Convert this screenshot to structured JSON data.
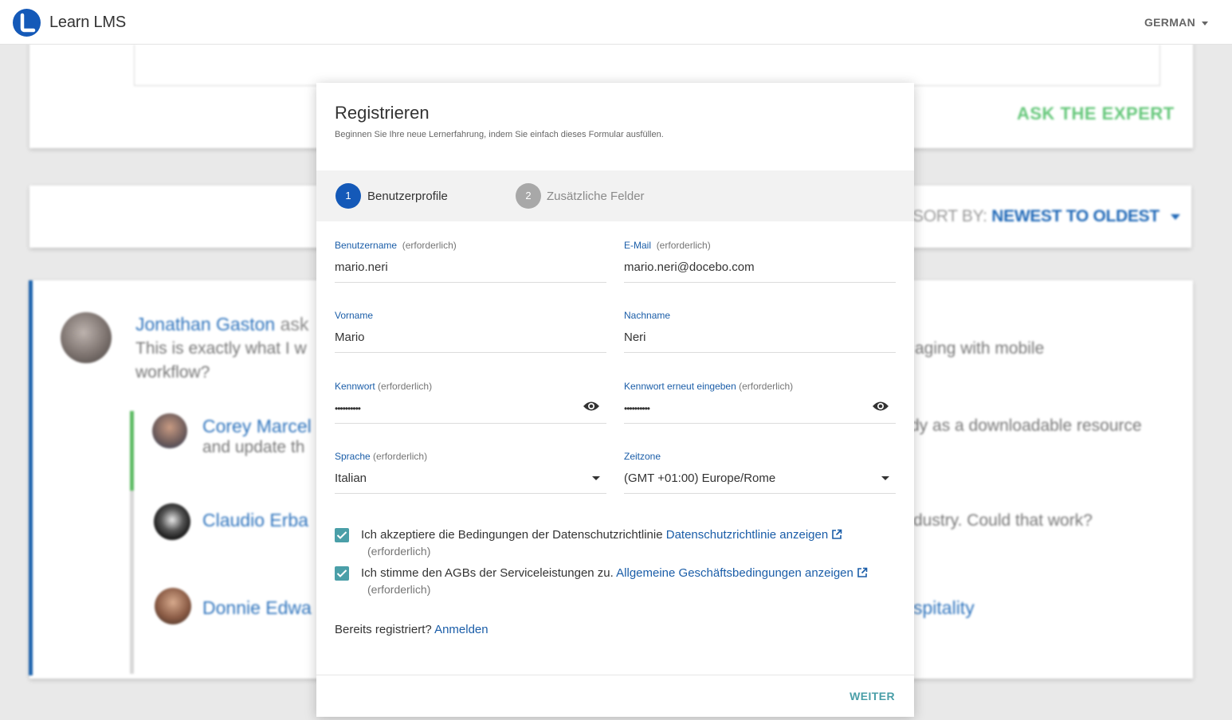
{
  "header": {
    "app_title": "Learn LMS",
    "language": "GERMAN"
  },
  "background": {
    "ask_expert": "ASK THE EXPERT",
    "sort_label": "SORT BY:",
    "sort_value": "NEWEST TO OLDEST",
    "posts": [
      {
        "name": "Jonathan Gaston",
        "action": "ask",
        "text_left": "This is exactly what I w",
        "text_left2": "workflow?",
        "text_right": "aging with mobile"
      },
      {
        "name": "Corey Marcel",
        "text_left": "and update th",
        "text_right": "dy as a downloadable resource"
      },
      {
        "name": "Claudio Erba",
        "text_right": "dustry.  Could that work?"
      },
      {
        "name": "Donnie Edwa",
        "text_right": "spitality"
      }
    ]
  },
  "modal": {
    "title": "Registrieren",
    "subtitle": "Beginnen Sie Ihre neue Lernerfahrung, indem Sie einfach dieses Formular ausfüllen.",
    "steps": [
      {
        "number": "1",
        "label": "Benutzerprofile",
        "active": true
      },
      {
        "number": "2",
        "label": "Zusätzliche Felder",
        "active": false
      }
    ],
    "fields": {
      "username": {
        "label": "Benutzername",
        "required": "(erforderlich)",
        "value": "mario.neri"
      },
      "email": {
        "label": "E-Mail",
        "required": "(erforderlich)",
        "value": "mario.neri@docebo.com"
      },
      "firstname": {
        "label": "Vorname",
        "value": "Mario"
      },
      "lastname": {
        "label": "Nachname",
        "value": "Neri"
      },
      "password": {
        "label": "Kennwort",
        "required": "(erforderlich)",
        "value": "••••••••••"
      },
      "password_repeat": {
        "label": "Kennwort erneut eingeben",
        "required": "(erforderlich)",
        "value": "••••••••••"
      },
      "language": {
        "label": "Sprache",
        "required": "(erforderlich)",
        "value": "Italian"
      },
      "timezone": {
        "label": "Zeitzone",
        "value": "(GMT +01:00) Europe/Rome"
      }
    },
    "consents": [
      {
        "text": "Ich akzeptiere die Bedingungen der Datenschutzrichtlinie ",
        "link": "Datenschutzrichtlinie anzeigen",
        "required": "(erforderlich)",
        "checked": true
      },
      {
        "text": "Ich stimme den AGBs der Serviceleistungen zu. ",
        "link": "Allgemeine Geschäftsbedingungen anzeigen",
        "required": "(erforderlich)",
        "checked": true
      }
    ],
    "already_registered": "Bereits registriert?",
    "login_link": "Anmelden",
    "next_button": "WEITER"
  },
  "colors": {
    "brand_blue": "#1459b8",
    "link_blue": "#1a5da8",
    "teal": "#4a9fa8",
    "expert_green": "#65c77a"
  }
}
